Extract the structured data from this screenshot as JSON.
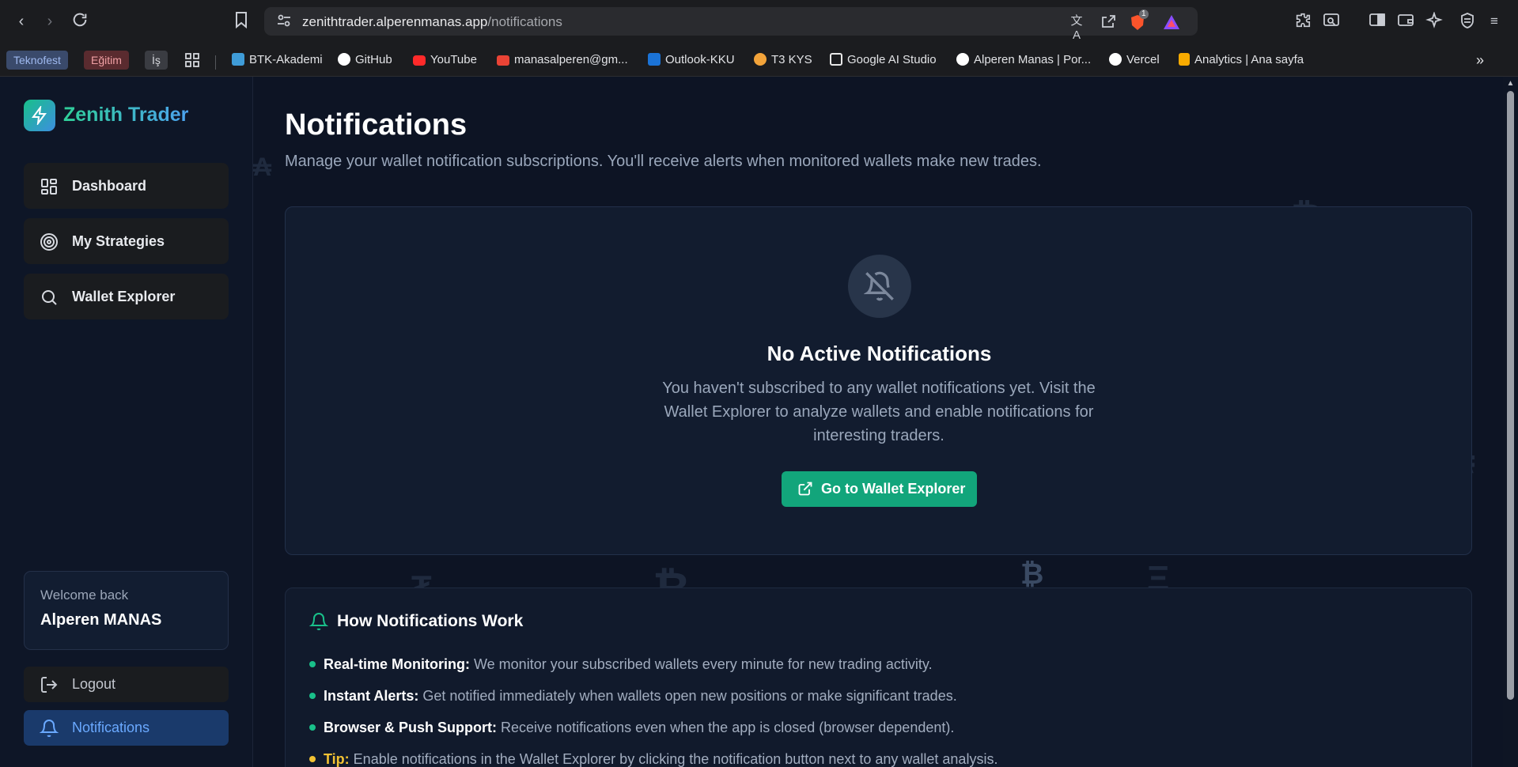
{
  "browser": {
    "url_host": "zenithtrader.alperenmanas.app",
    "url_path": "/notifications",
    "shield_badge": "1"
  },
  "bookmarks": {
    "tags": [
      {
        "label": "Teknofest",
        "bg": "#3a4a6b",
        "color": "#9fb9ef"
      },
      {
        "label": "Eğitim",
        "bg": "#5a2b2f",
        "color": "#f0a0a4"
      },
      {
        "label": "İş",
        "bg": "#3a3c42",
        "color": "#d5d7dc"
      }
    ],
    "items": [
      {
        "label": "BTK-Akademi",
        "color": "#3f9cd8"
      },
      {
        "label": "GitHub",
        "color": "#ffffff"
      },
      {
        "label": "YouTube",
        "color": "#ff2a2a"
      },
      {
        "label": "manasalperen@gm...",
        "color": "#ea4335"
      },
      {
        "label": "Outlook-KKU",
        "color": "#1b73d6"
      },
      {
        "label": "T3 KYS",
        "color": "#f2a33a"
      },
      {
        "label": "Google AI Studio",
        "color": "#e8e8e8"
      },
      {
        "label": "Alperen Manas | Por...",
        "color": "#ffffff"
      },
      {
        "label": "Vercel",
        "color": "#ffffff"
      },
      {
        "label": "Analytics | Ana sayfa",
        "color": "#f9ab00"
      }
    ]
  },
  "sidebar": {
    "brand": "Zenith Trader",
    "nav": [
      {
        "label": "Dashboard"
      },
      {
        "label": "My Strategies"
      },
      {
        "label": "Wallet Explorer"
      }
    ],
    "welcome_label": "Welcome back",
    "user_name": "Alperen MANAS",
    "logout_label": "Logout",
    "notifications_label": "Notifications"
  },
  "main": {
    "title": "Notifications",
    "subtitle": "Manage your wallet notification subscriptions. You'll receive alerts when monitored wallets make new trades.",
    "empty_title": "No Active Notifications",
    "empty_text": "You haven't subscribed to any wallet notifications yet. Visit the Wallet Explorer to analyze wallets and enable notifications for interesting traders.",
    "go_button": "Go to Wallet Explorer",
    "how_title": "How Notifications Work",
    "how_items": [
      {
        "title": "Real-time Monitoring:",
        "text": " We monitor your subscribed wallets every minute for new trading activity."
      },
      {
        "title": "Instant Alerts:",
        "text": " Get notified immediately when wallets open new positions or make significant trades."
      },
      {
        "title": "Browser & Push Support:",
        "text": " Receive notifications even when the app is closed (browser dependent)."
      },
      {
        "title": "Tip:",
        "text": " Enable notifications in the Wallet Explorer by clicking the notification button next to any wallet analysis."
      }
    ]
  },
  "colors": {
    "accent": "#12a57b",
    "active_nav_bg": "#1a3a6b",
    "active_nav_text": "#6aa9ff",
    "background": "#0d1424"
  }
}
